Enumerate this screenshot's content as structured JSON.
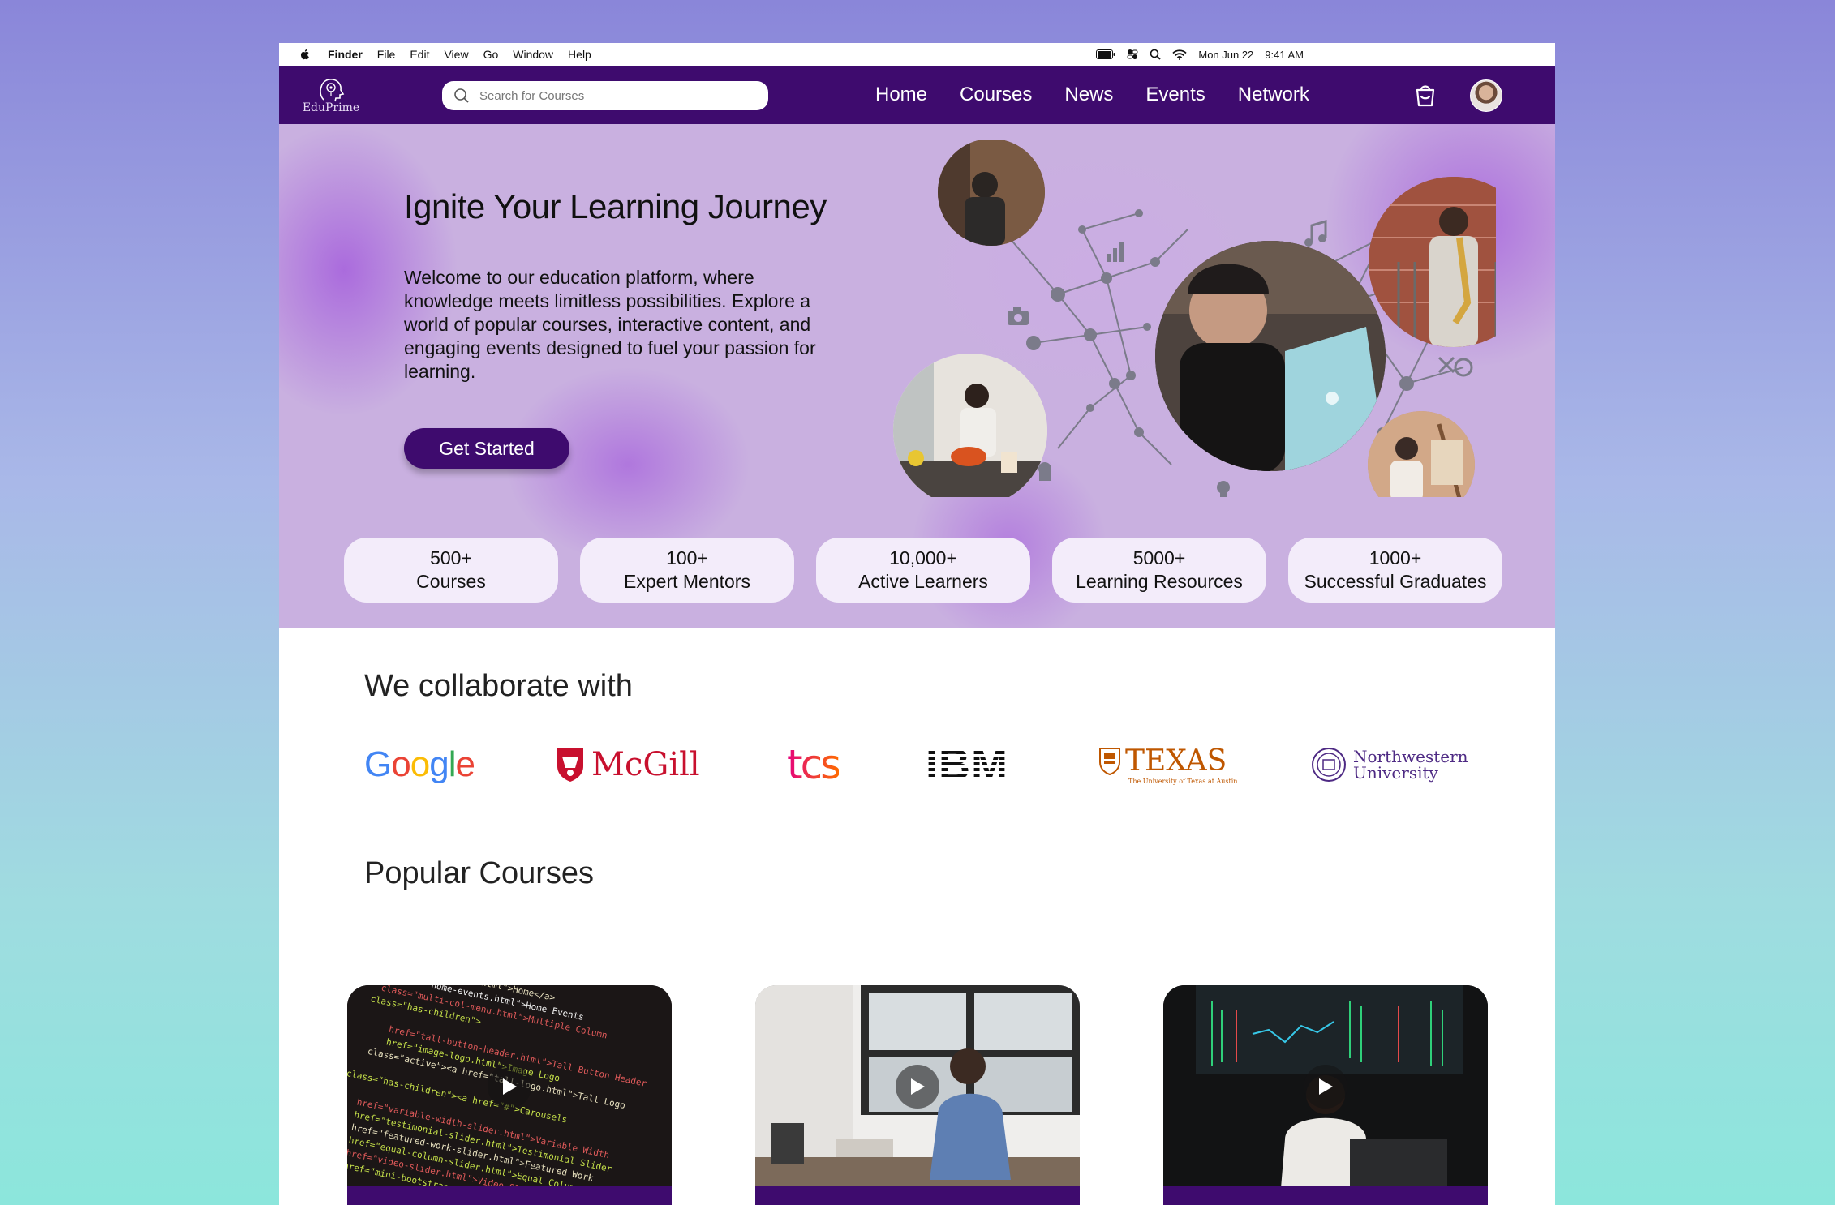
{
  "menubar": {
    "app": "Finder",
    "items": [
      "File",
      "Edit",
      "View",
      "Go",
      "Window",
      "Help"
    ],
    "date": "Mon Jun 22",
    "time": "9:41 AM"
  },
  "nav": {
    "logo_text": "EduPrime",
    "search_placeholder": "Search for Courses",
    "links": [
      "Home",
      "Courses",
      "News",
      "Events",
      "Network"
    ]
  },
  "hero": {
    "title": "Ignite Your Learning Journey",
    "description": "Welcome to our education platform, where knowledge meets limitless possibilities. Explore a world of popular courses, interactive content, and engaging events designed to fuel your passion for learning.",
    "cta_label": "Get Started"
  },
  "stats": [
    {
      "value": "500+",
      "label": "Courses"
    },
    {
      "value": "100+",
      "label": "Expert Mentors"
    },
    {
      "value": "10,000+",
      "label": "Active Learners"
    },
    {
      "value": "5000+",
      "label": "Learning Resources"
    },
    {
      "value": "1000+",
      "label": "Successful Graduates"
    }
  ],
  "collaborate": {
    "title": "We collaborate with",
    "partners": {
      "google": "Google",
      "mcgill": "McGill",
      "tcs": "tcs",
      "ibm": "IBM",
      "texas": "TEXAS",
      "texas_sub": "The University of Texas at Austin",
      "northwestern_line1": "Northwestern",
      "northwestern_line2": "University"
    }
  },
  "courses": {
    "title": "Popular Courses"
  },
  "colors": {
    "brand_purple": "#3e0b6e",
    "hero_lavender": "#c9b0e0",
    "stat_pill": "#f3ecfa"
  }
}
